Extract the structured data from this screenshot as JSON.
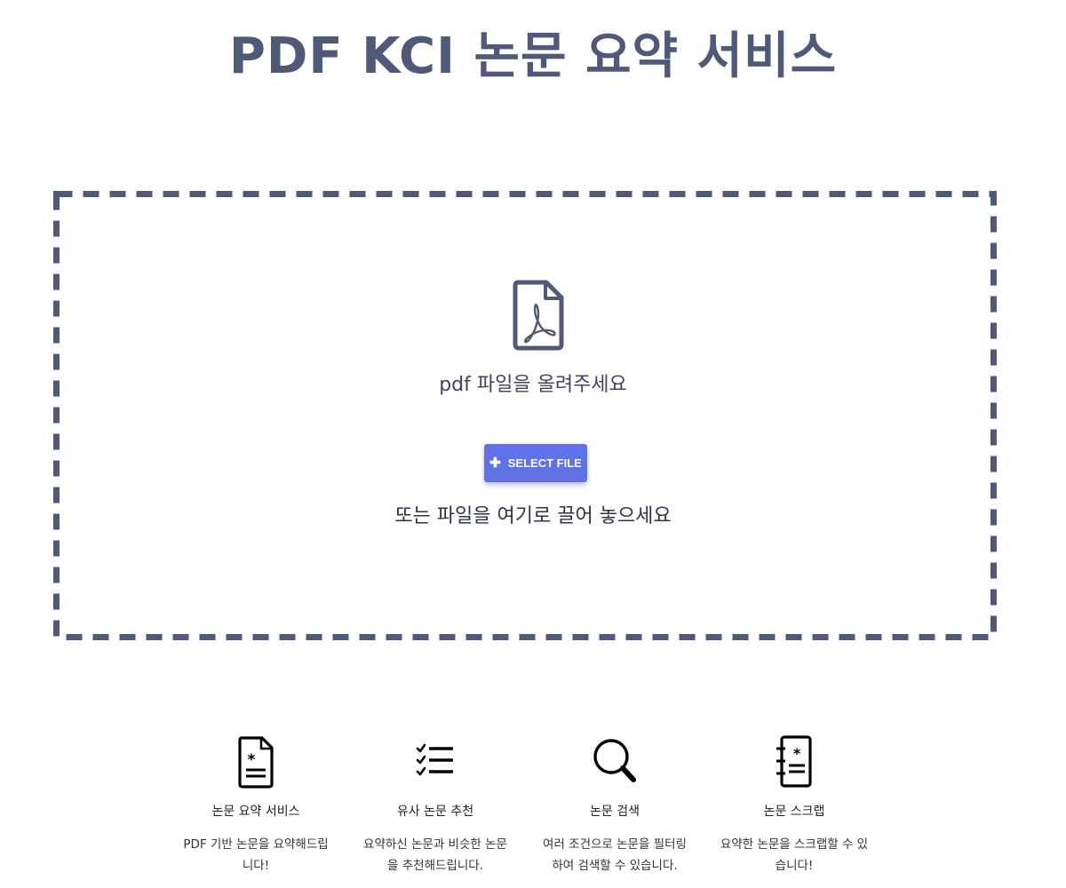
{
  "header": {
    "title": "PDF KCI 논문 요약 서비스"
  },
  "dropzone": {
    "icon": "pdf-file-icon",
    "prompt": "pdf 파일을 올려주세요",
    "select_button_label": "SELECT FILE",
    "select_button_icon": "plus-icon",
    "drag_prompt": "또는 파일을 여기로 끌어 놓으세요"
  },
  "features": [
    {
      "icon": "document-asterisk-icon",
      "name": "논문 요약 서비스",
      "description": "PDF 기반 논문을 요약해드립니다!"
    },
    {
      "icon": "checklist-icon",
      "name": "유사 논문 추천",
      "description": "요약하신 논문과 비슷한 논문을 추천해드립니다."
    },
    {
      "icon": "search-icon",
      "name": "논문 검색",
      "description": "여러 조건으로 논문을 필터링하여 검색할 수 있습니다."
    },
    {
      "icon": "notebook-asterisk-icon",
      "name": "논문 스크랩",
      "description": "요약한 논문을 스크랩할 수 있습니다!"
    }
  ],
  "colors": {
    "primary": "#4f5a79",
    "button": "#6072e6",
    "text": "#2f3346"
  }
}
